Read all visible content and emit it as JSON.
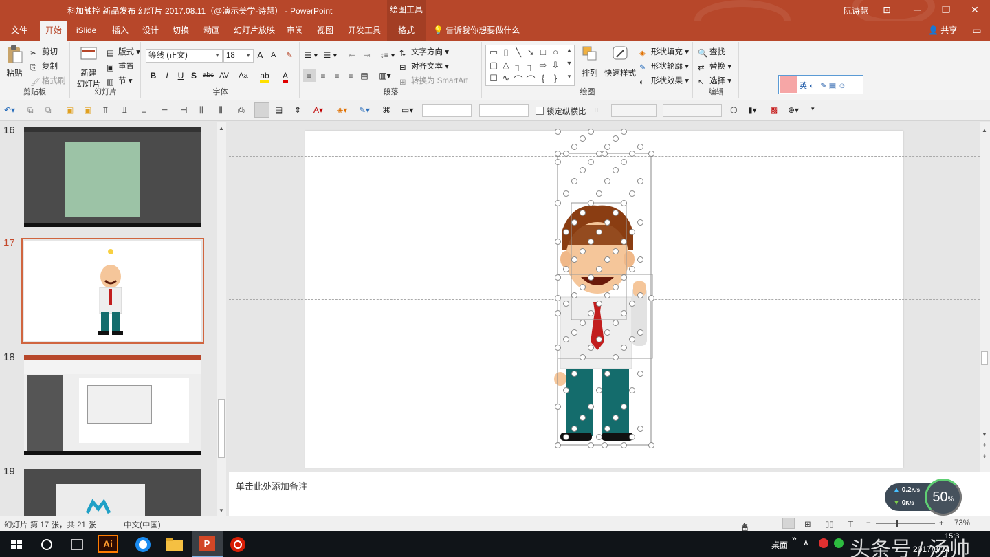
{
  "titlebar": {
    "title": "科加触控 新品发布 幻灯片 2017.08.11（@演示美学-诗慧） - PowerPoint",
    "context_tools": "绘图工具",
    "user": "阮诗慧",
    "minimize": "─",
    "restore": "❐",
    "close": "✕",
    "ribbon_display": "⊡"
  },
  "tabs": [
    {
      "label": "文件"
    },
    {
      "label": "开始"
    },
    {
      "label": "iSlide"
    },
    {
      "label": "插入"
    },
    {
      "label": "设计"
    },
    {
      "label": "切换"
    },
    {
      "label": "动画"
    },
    {
      "label": "幻灯片放映"
    },
    {
      "label": "审阅"
    },
    {
      "label": "视图"
    },
    {
      "label": "开发工具"
    },
    {
      "label": "格式"
    }
  ],
  "tell_me": "告诉我你想要做什么",
  "share": "共享",
  "ribbon": {
    "clipboard": {
      "label": "剪贴板",
      "paste": "粘贴",
      "cut": "剪切",
      "copy": "复制",
      "format_painter": "格式刷"
    },
    "slides": {
      "label": "幻灯片",
      "new_slide_1": "新建",
      "new_slide_2": "幻灯片",
      "layout": "版式",
      "reset": "重置",
      "section": "节"
    },
    "font": {
      "label": "字体",
      "font_name": "等线 (正文)",
      "font_size": "18",
      "grow": "A",
      "shrink": "A",
      "bold": "B",
      "italic": "I",
      "underline": "U",
      "shadow": "S",
      "strike": "abc",
      "spacing": "AV",
      "case": "Aa"
    },
    "paragraph": {
      "label": "段落",
      "text_direction": "文字方向",
      "align_text": "对齐文本",
      "smartart": "转换为 SmartArt"
    },
    "drawing": {
      "label": "绘图",
      "arrange": "排列",
      "quick_styles": "快速样式",
      "shape_fill": "形状填充",
      "shape_outline": "形状轮廓",
      "shape_effects": "形状效果"
    },
    "editing": {
      "label": "编辑",
      "find": "查找",
      "replace": "替换",
      "select": "选择"
    }
  },
  "qat": {
    "lock_aspect": "锁定纵横比"
  },
  "thumbnails": [
    {
      "num": "16",
      "active": false
    },
    {
      "num": "17",
      "active": true
    },
    {
      "num": "18",
      "active": false
    },
    {
      "num": "19",
      "active": false
    }
  ],
  "notes_placeholder": "单击此处添加备注",
  "net": {
    "up": "0.2",
    "down": "0",
    "unit": "K/s",
    "percent": "50",
    "pct_sign": "%"
  },
  "statusbar": {
    "slide_info": "幻灯片 第 17 张，共 21 张",
    "language": "中文(中国)",
    "notes": "备注",
    "zoom_minus": "−",
    "zoom_plus": "+",
    "zoom": "73%"
  },
  "taskbar": {
    "desktop": "桌面",
    "time": "15:3",
    "date": "2017/8/14",
    "watermark": "头条号 / 汤帅",
    "ai_label": "Ai",
    "ppt_label": "P"
  },
  "colors": {
    "accent": "#b7472a",
    "selection": "#d0653f"
  }
}
